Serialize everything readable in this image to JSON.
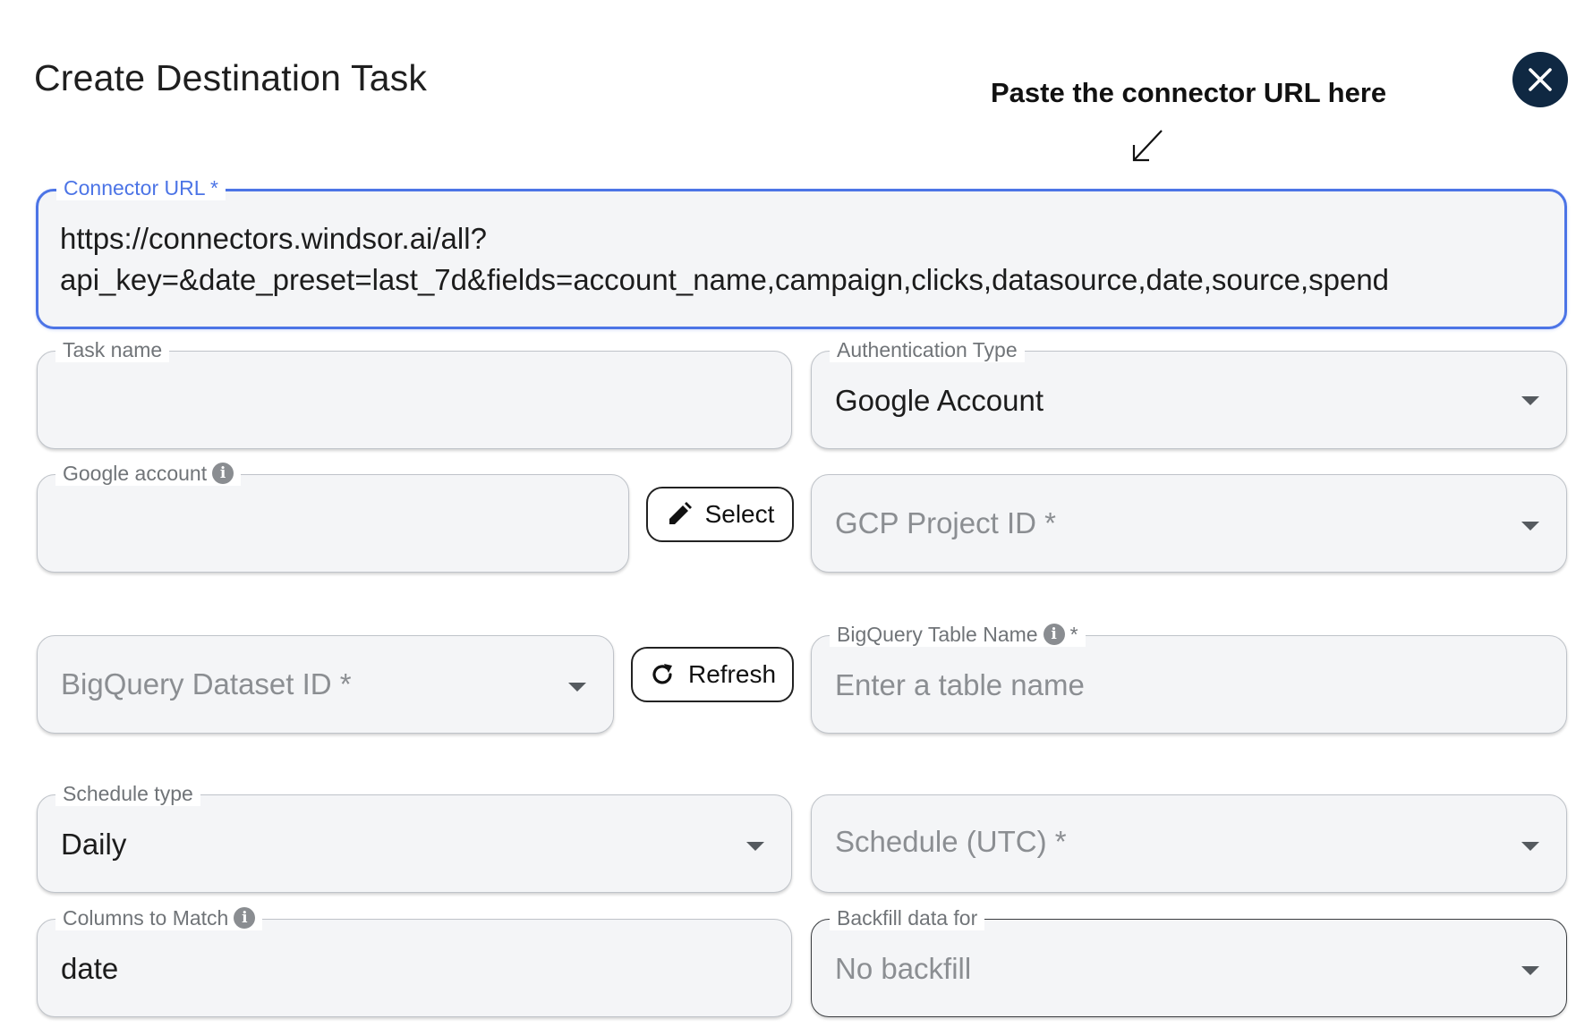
{
  "dialog": {
    "title": "Create Destination Task",
    "hint": "Paste the connector URL here"
  },
  "connector_url": {
    "label": "Connector URL *",
    "line1": "https://connectors.windsor.ai/all?",
    "line2": "api_key=&date_preset=last_7d&fields=account_name,campaign,clicks,datasource,date,source,spend"
  },
  "task_name": {
    "label": "Task name",
    "value": ""
  },
  "auth_type": {
    "label": "Authentication Type",
    "value": "Google Account"
  },
  "google_account": {
    "label": "Google account",
    "value": ""
  },
  "select_button": {
    "label": "Select"
  },
  "gcp_project": {
    "placeholder": "GCP Project ID *"
  },
  "dataset": {
    "placeholder": "BigQuery Dataset ID *"
  },
  "refresh_button": {
    "label": "Refresh"
  },
  "table_name": {
    "label": "BigQuery Table Name",
    "required_mark": "*",
    "placeholder": "Enter a table name"
  },
  "schedule_type": {
    "label": "Schedule type",
    "value": "Daily"
  },
  "schedule_utc": {
    "placeholder": "Schedule (UTC) *"
  },
  "columns_match": {
    "label": "Columns to Match",
    "value": "date"
  },
  "backfill": {
    "label": "Backfill data for",
    "value": "No backfill"
  },
  "colors": {
    "accent": "#4c74e6",
    "close_bg": "#0f2842",
    "field_bg": "#f4f5f7"
  }
}
